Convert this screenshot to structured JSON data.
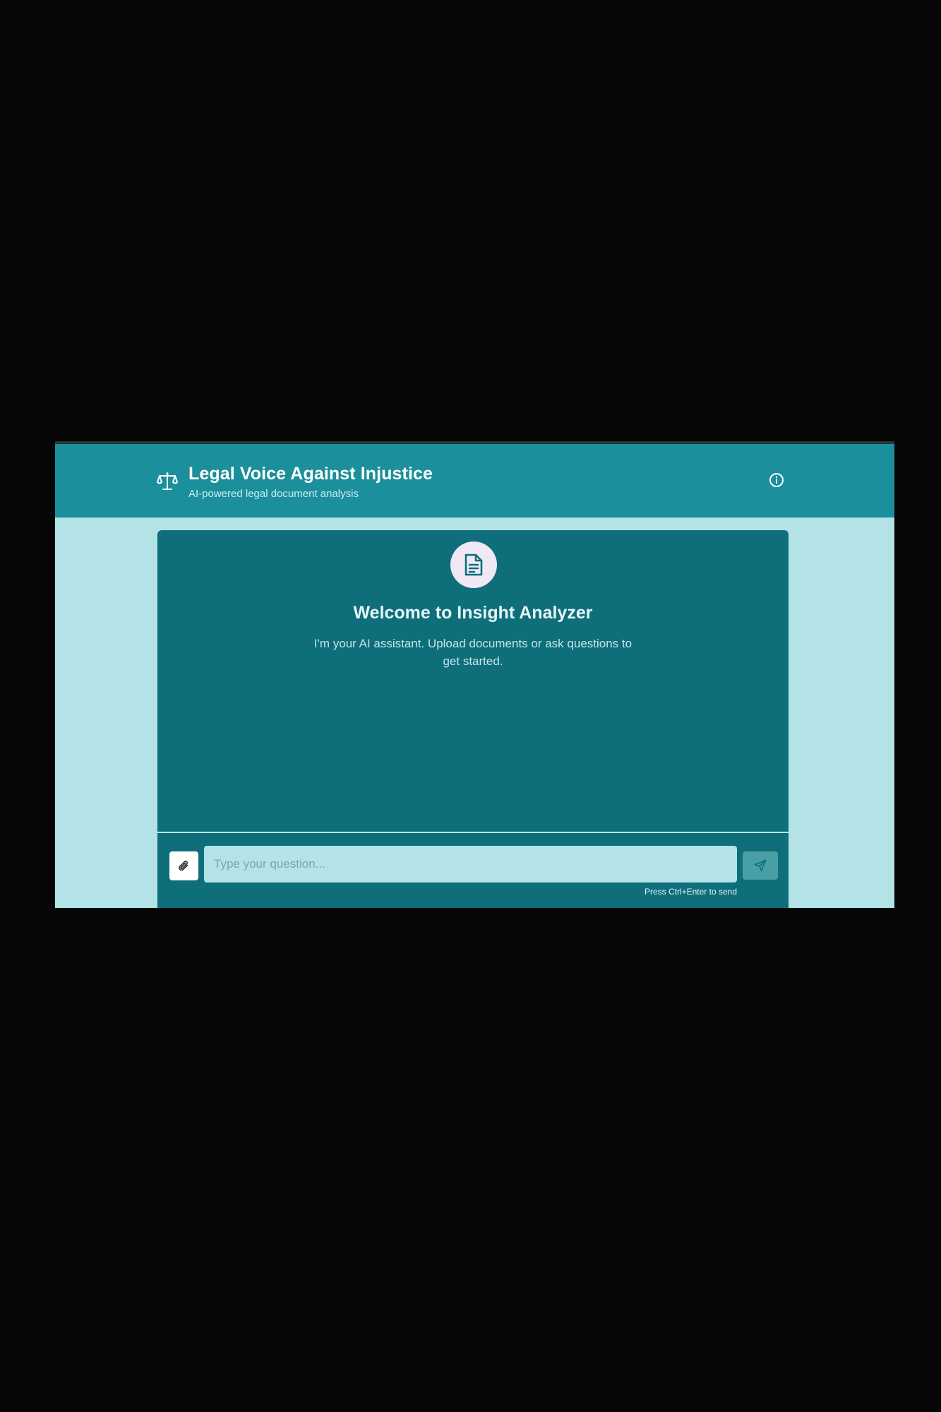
{
  "header": {
    "title": "Legal Voice Against Injustice",
    "subtitle": "AI-powered legal document analysis",
    "logo_icon": "scales-of-justice-icon",
    "info_icon": "info-circle-icon"
  },
  "welcome": {
    "icon": "document-icon",
    "title": "Welcome to Insight Analyzer",
    "message": "I'm your AI assistant. Upload documents or ask questions to get started."
  },
  "composer": {
    "attach_icon": "paperclip-icon",
    "placeholder": "Type your question...",
    "value": "",
    "send_icon": "send-icon",
    "hint": "Press Ctrl+Enter to send"
  },
  "colors": {
    "header_bg": "#1b8f9b",
    "panel_bg": "#0e6e7a",
    "page_bg": "#b3e2e7",
    "send_button_bg": "#4a9ea6"
  }
}
